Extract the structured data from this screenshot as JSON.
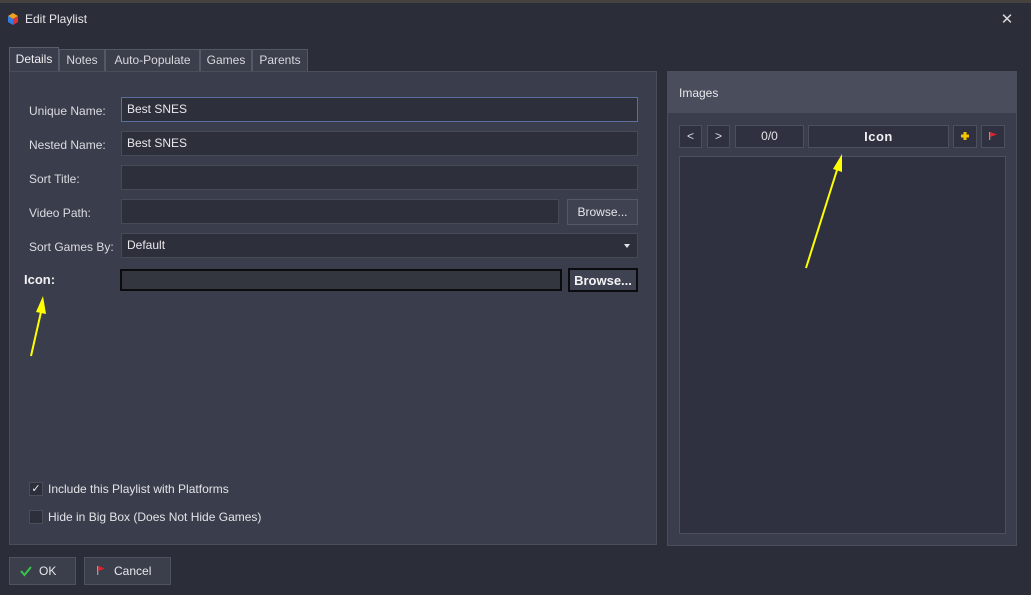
{
  "window": {
    "title": "Edit Playlist",
    "close_label": "✕"
  },
  "tabs": [
    {
      "label": "Details"
    },
    {
      "label": "Notes"
    },
    {
      "label": "Auto-Populate"
    },
    {
      "label": "Games"
    },
    {
      "label": "Parents"
    }
  ],
  "details": {
    "unique_name": {
      "label": "Unique Name:",
      "value": "Best SNES"
    },
    "nested_name": {
      "label": "Nested Name:",
      "value": "Best SNES"
    },
    "sort_title": {
      "label": "Sort Title:",
      "value": ""
    },
    "video_path": {
      "label": "Video Path:",
      "value": "",
      "browse_label": "Browse..."
    },
    "sort_games_by": {
      "label": "Sort Games By:",
      "value": "Default"
    },
    "icon": {
      "label": "Icon:",
      "value": "",
      "browse_label": "Browse..."
    },
    "include_platforms": {
      "label": "Include this Playlist with Platforms",
      "checked": true,
      "mark": "✓"
    },
    "hide_bigbox": {
      "label": "Hide in Big Box (Does Not Hide Games)",
      "checked": false,
      "mark": ""
    }
  },
  "images": {
    "title": "Images",
    "prev_label": "<",
    "next_label": ">",
    "counter": "0/0",
    "type": "Icon"
  },
  "footer": {
    "ok_label": "OK",
    "cancel_label": "Cancel"
  },
  "icons": {
    "app": "launchbox-cube-icon",
    "ok": "check-icon",
    "cancel": "red-flag-icon",
    "add": "plus-icon",
    "remove": "red-flag-icon"
  },
  "colors": {
    "background": "#2b2d38",
    "panel": "#3a3d4b",
    "field": "#2d2f3b",
    "annotation_arrow": "#ffff00",
    "ok_check": "#35c64a",
    "cancel_flag": "#e0202a",
    "add_plus": "#f2c500"
  }
}
